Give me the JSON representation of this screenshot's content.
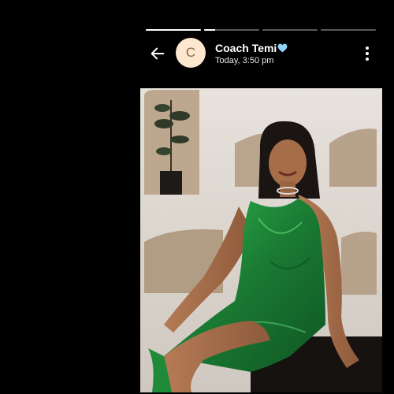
{
  "story": {
    "progress_segments": [
      1.0,
      0.2,
      0.0,
      0.0
    ],
    "contact": {
      "name": "Coach Temi",
      "avatar_initial": "C",
      "timestamp": "Today, 3:50 pm"
    },
    "colors": {
      "background": "#000000",
      "avatar_bg": "#fde7cf",
      "heart": "#8fd3f4",
      "dress": "#1f8a3a"
    },
    "icons": {
      "back": "arrow-left-icon",
      "menu": "more-vertical-icon",
      "heart": "light-blue-heart-icon"
    }
  }
}
